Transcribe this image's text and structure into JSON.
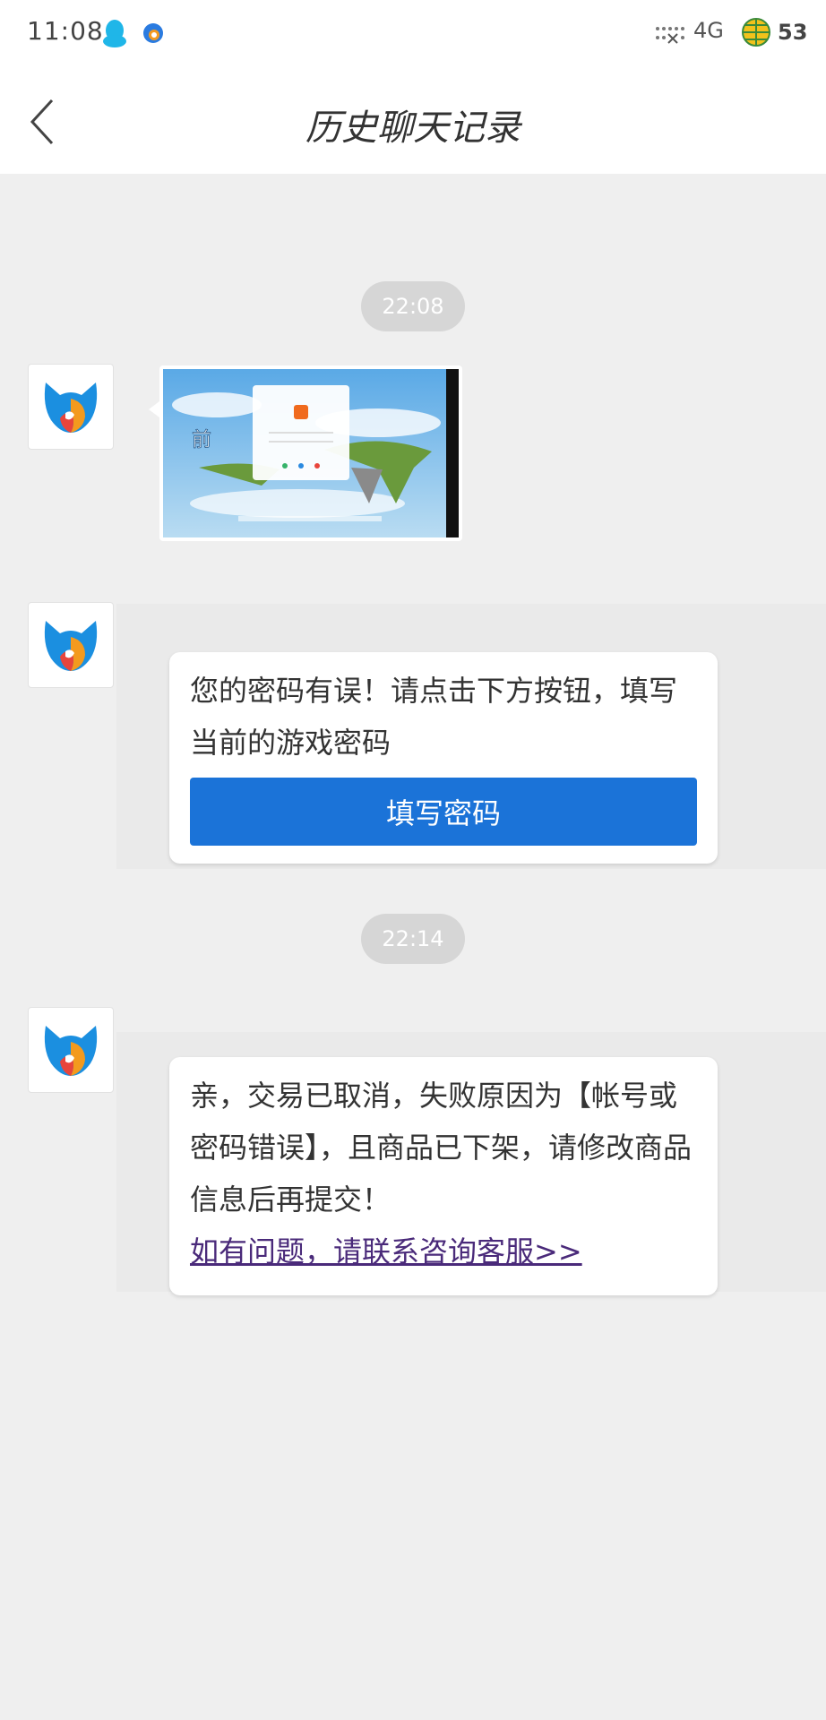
{
  "status_bar": {
    "time": "11:08",
    "network": "4G",
    "battery": "53"
  },
  "nav": {
    "title": "历史聊天记录"
  },
  "messages": [
    {
      "time": "22:08",
      "type": "image"
    },
    {
      "type": "card",
      "text": "您的密码有误！请点击下方按钮，填写当前的游戏密码",
      "button_label": "填写密码"
    },
    {
      "time": "22:14",
      "type": "card",
      "text": "亲，交易已取消，失败原因为【帐号或密码错误】，且商品已下架，请修改商品信息后再提交！",
      "link": "如有问题，请联系咨询客服>>"
    }
  ],
  "colors": {
    "accent": "#1b73d8",
    "background": "#efefef",
    "link": "#4a2a7a"
  }
}
